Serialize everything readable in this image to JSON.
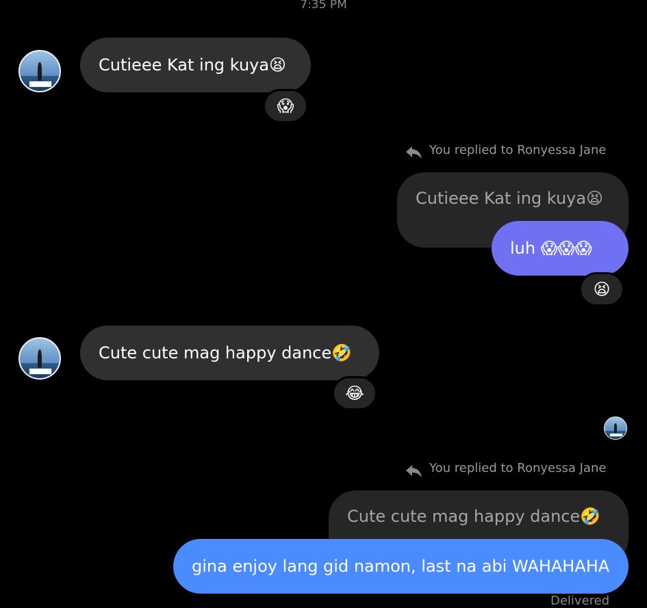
{
  "timestamp": "7:35 PM",
  "colors": {
    "background": "#000000",
    "incoming_bubble": "#303030",
    "quoted_bubble": "#262626",
    "outgoing_bubble_1": "#6f71f2",
    "outgoing_bubble_2": "#4a8cff",
    "secondary_text": "#9a9a9a"
  },
  "messages": [
    {
      "text": "Cutieee Kat ing kuya😫",
      "reaction": "😱"
    },
    {
      "replied_label": "You replied to Ronyessa Jane",
      "quoted_text": "Cutieee Kat ing kuya😫",
      "text": "luh 😱😱😱",
      "reaction": "😫"
    },
    {
      "text": "Cute cute mag happy dance🤣",
      "reaction": "😂"
    },
    {
      "replied_label": "You replied to Ronyessa Jane",
      "quoted_text": "Cute cute mag happy dance🤣",
      "text": "gina enjoy lang gid namon, last na abi WAHAHAHA"
    }
  ],
  "footer_status": "Delivered",
  "icons": {
    "avatar": "contact-avatar",
    "reply": "reply-arrow-icon",
    "seen": "seen-avatar-icon"
  }
}
